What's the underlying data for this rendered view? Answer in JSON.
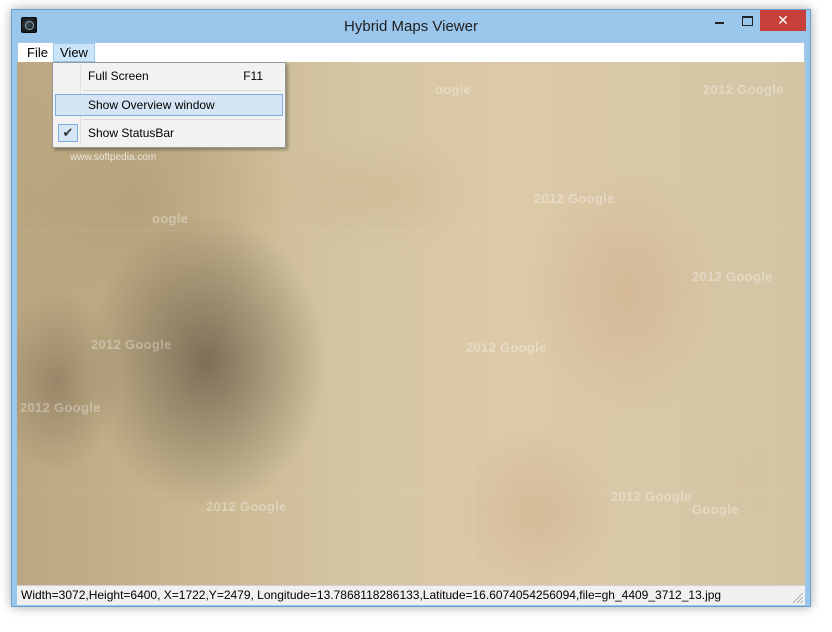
{
  "window": {
    "title": "Hybrid Maps Viewer",
    "close_glyph": "✕",
    "icons": {
      "app": "globe-icon",
      "minimize": "minimize-icon",
      "maximize": "maximize-icon",
      "close": "close-icon"
    }
  },
  "menubar": {
    "items": [
      {
        "label": "File"
      },
      {
        "label": "View"
      }
    ]
  },
  "view_menu": {
    "items": [
      {
        "label": "Full Screen",
        "shortcut": "F11"
      },
      {
        "label": "Show Overview window"
      },
      {
        "label": "Show StatusBar",
        "checked": true,
        "check_glyph": "✔"
      }
    ]
  },
  "map": {
    "watermark": "2012 Google",
    "watermark_short": "oogle",
    "watermark_google": "Google",
    "credit": "www.softpedia.com"
  },
  "status": {
    "text": "Width=3072,Height=6400, X=1722,Y=2479, Longitude=13.7868118286133,Latitude=16.6074054256094,file=gh_4409_3712_13.jpg"
  },
  "colors": {
    "frame": "#9bc6ec",
    "close_button": "#c7403a",
    "menu_highlight": "#cce4f7"
  }
}
